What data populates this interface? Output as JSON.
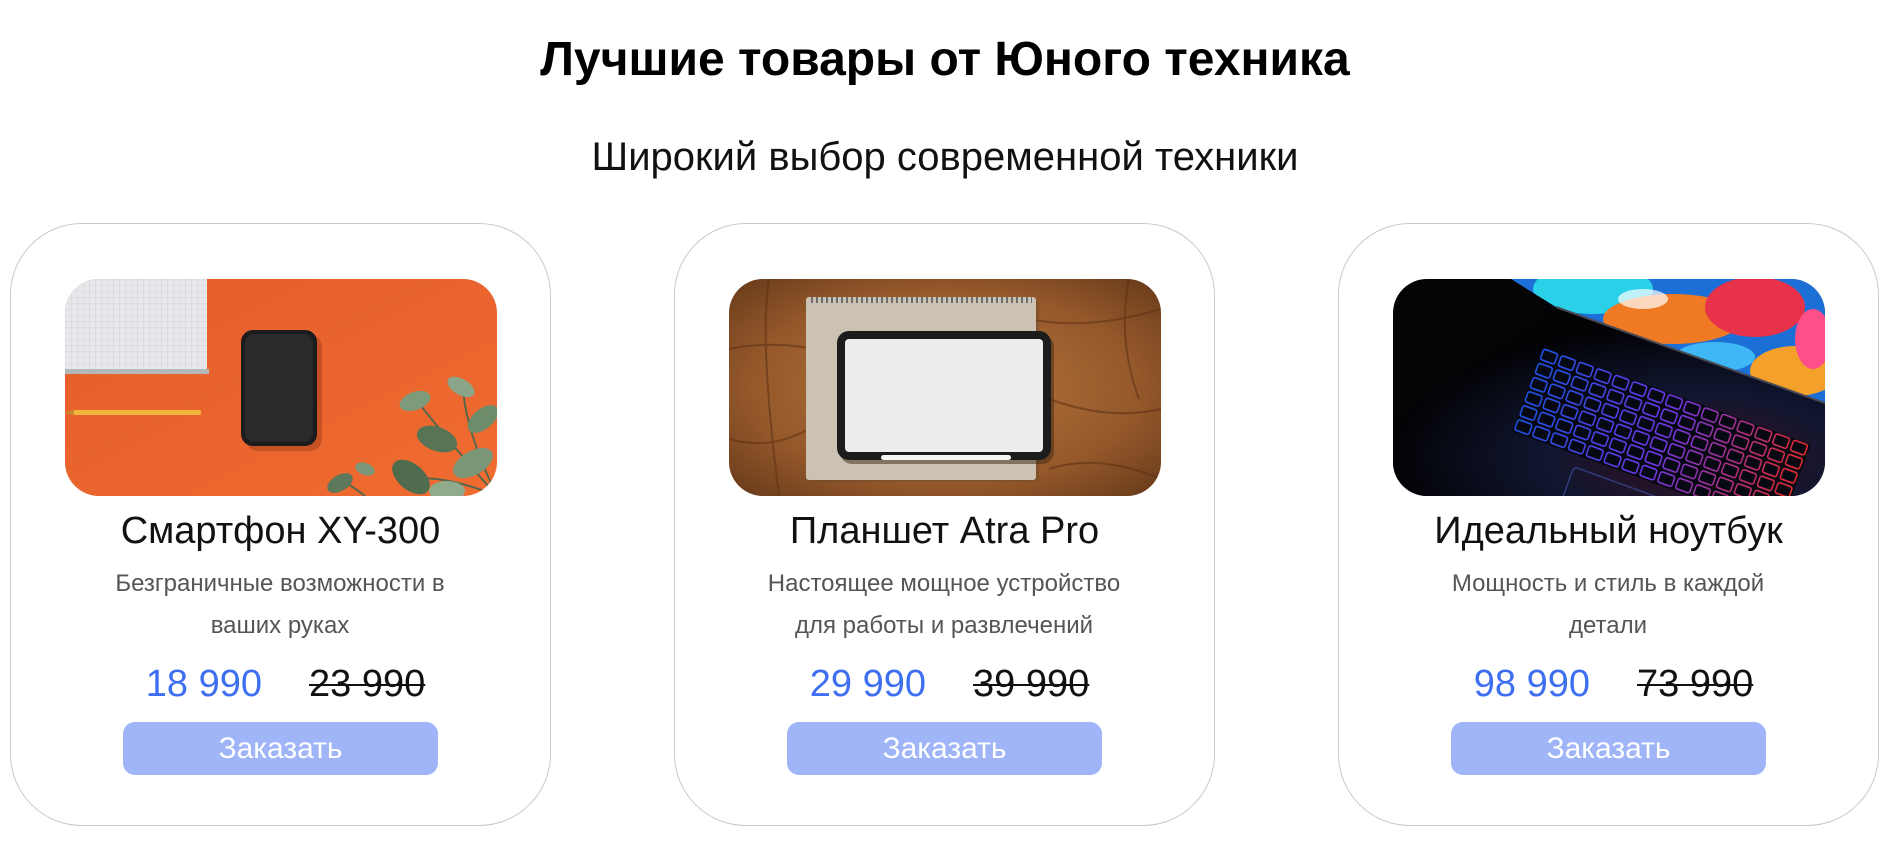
{
  "header": {
    "title": "Лучшие товары от Юного техника",
    "subtitle": "Широкий выбор современной техники"
  },
  "products": [
    {
      "name": "Смартфон XY-300",
      "description": "Безграничные возможности в ваших руках",
      "price": "18 990",
      "old_price": "23 990",
      "button_label": "Заказать",
      "image": "smartphone-photo"
    },
    {
      "name": "Планшет Atra Pro",
      "description": "Настоящее мощное устройство для работы и развлечений",
      "price": "29 990",
      "old_price": "39 990",
      "button_label": "Заказать",
      "image": "tablet-photo"
    },
    {
      "name": "Идеальный ноутбук",
      "description": "Мощность и стиль в каждой детали",
      "price": "98 990",
      "old_price": "73 990",
      "button_label": "Заказать",
      "image": "laptop-photo"
    }
  ],
  "colors": {
    "price": "#3e6ff2",
    "button": "#a0b4f8",
    "card_border": "#c9c9c9"
  }
}
